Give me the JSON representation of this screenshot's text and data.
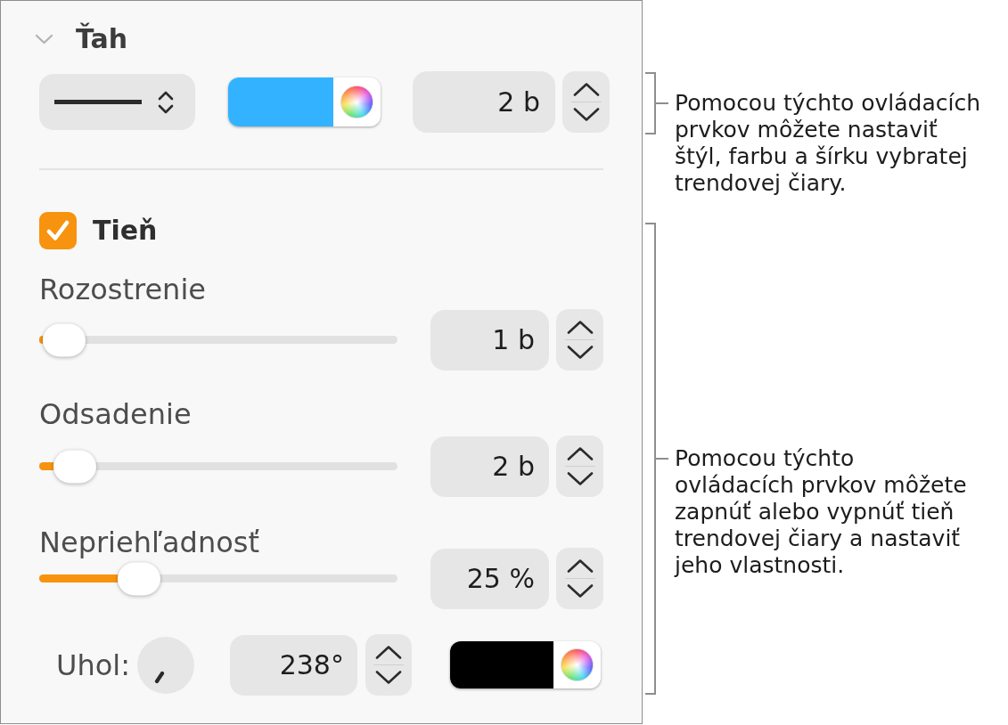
{
  "inspector": {
    "stroke": {
      "title": "Ťah",
      "expanded": true,
      "color": "#33b3ff",
      "width": "2 b"
    },
    "shadow": {
      "label": "Tieň",
      "checked": true,
      "sliders": [
        {
          "label": "Rozostrenie",
          "level": 0.01,
          "value": "1 b"
        },
        {
          "label": "Odsadenie",
          "level": 0.04,
          "value": "2 b"
        },
        {
          "label": "Nepriehľadnosť",
          "level": 0.22,
          "value": "25 %"
        }
      ],
      "angle": {
        "label": "Uhol:",
        "value": "238°"
      },
      "color": "#000000"
    }
  },
  "callouts": [
    {
      "text": "Pomocou týchto ovládacích prvkov môžete nastaviť štýl, farbu a šírku vybratej trendovej čiary."
    },
    {
      "text": "Pomocou týchto ovládacích prvkov môžete zapnúť alebo vypnúť tieň trendovej čiary a nastaviť jeho vlastnosti."
    }
  ]
}
